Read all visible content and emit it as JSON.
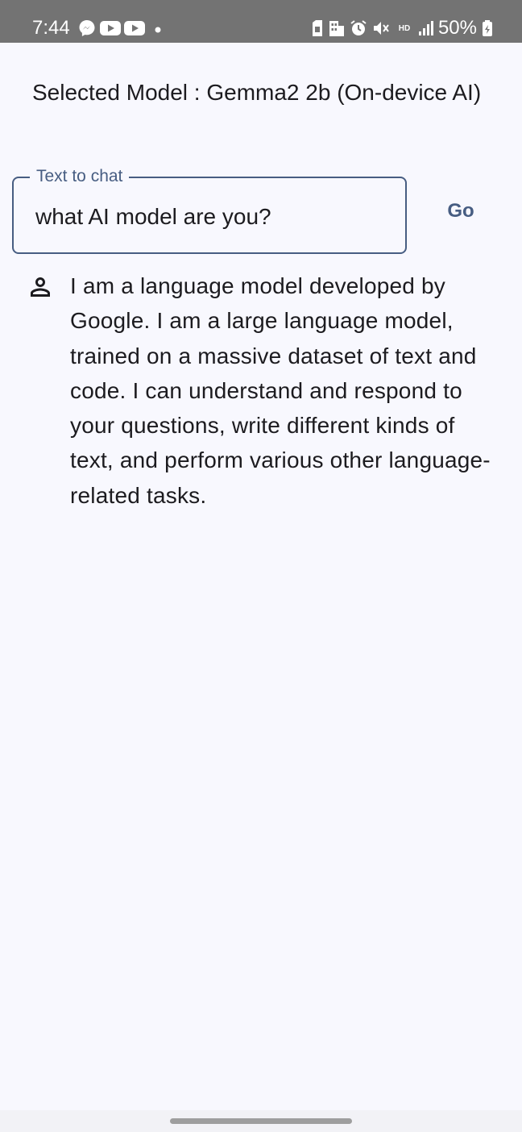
{
  "status_bar": {
    "time": "7:44",
    "battery": "50%",
    "hd_voice": "HD",
    "left_icons": [
      "messenger-icon",
      "youtube-icon",
      "youtube-icon",
      "dot-icon"
    ],
    "right_icons": [
      "sim-icon",
      "building-icon",
      "alarm-icon",
      "mute-icon",
      "hd-voice-icon",
      "signal-icon",
      "battery-icon"
    ]
  },
  "model": {
    "label": "Selected Model : Gemma2 2b (On-device AI)"
  },
  "chat_input": {
    "label": "Text to chat",
    "value": "what AI model are you?"
  },
  "go_button": {
    "label": "Go"
  },
  "response": {
    "icon": "person-icon",
    "text": "I am a language model developed by Google. I am a large language model, trained on a massive dataset of text and code. I can understand and respond to your questions, write different kinds of text, and perform various other language-related tasks."
  },
  "colors": {
    "background": "#f8f8fe",
    "accent": "#475d82",
    "text": "#1c1b1f",
    "status_bar": "#737373"
  }
}
